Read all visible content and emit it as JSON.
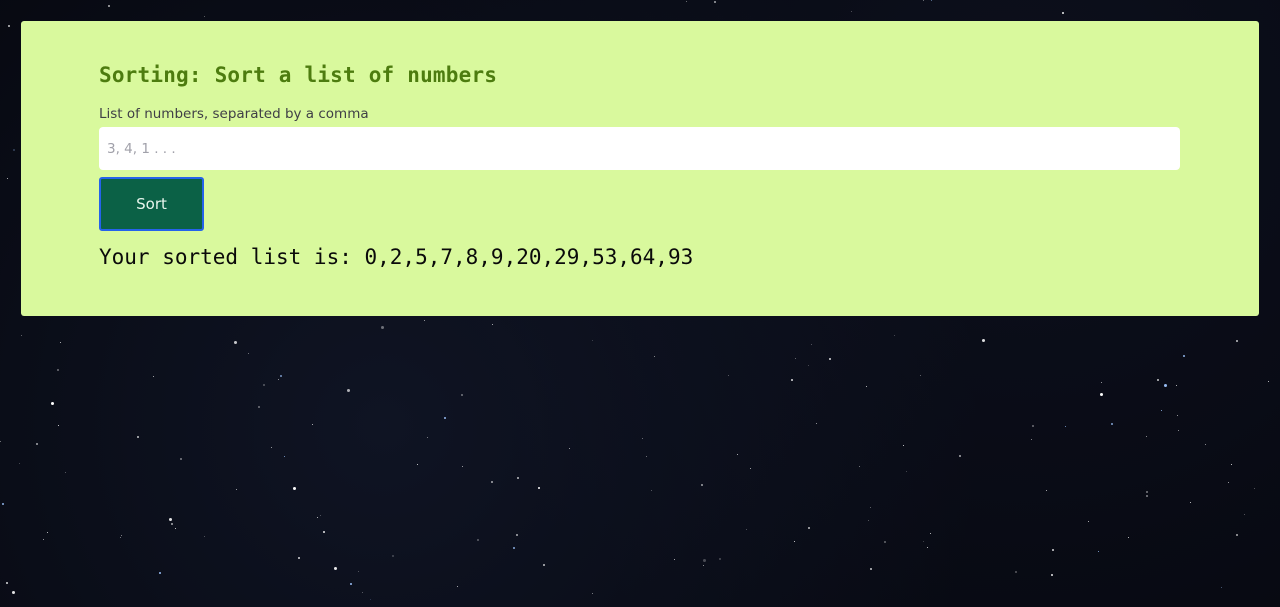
{
  "page": {
    "background": "starry night sky",
    "card_color": "#d9f99d",
    "accent_title_color": "#4d7c0f",
    "button_color": "#0b6146"
  },
  "form": {
    "title": "Sorting: Sort a list of numbers",
    "input_label": "List of numbers, separated by a comma",
    "input_placeholder": "3, 4, 1 . . .",
    "input_value": "",
    "submit_label": "Sort"
  },
  "result": {
    "text": "Your sorted list is: 0,2,5,7,8,9,20,29,53,64,93"
  }
}
